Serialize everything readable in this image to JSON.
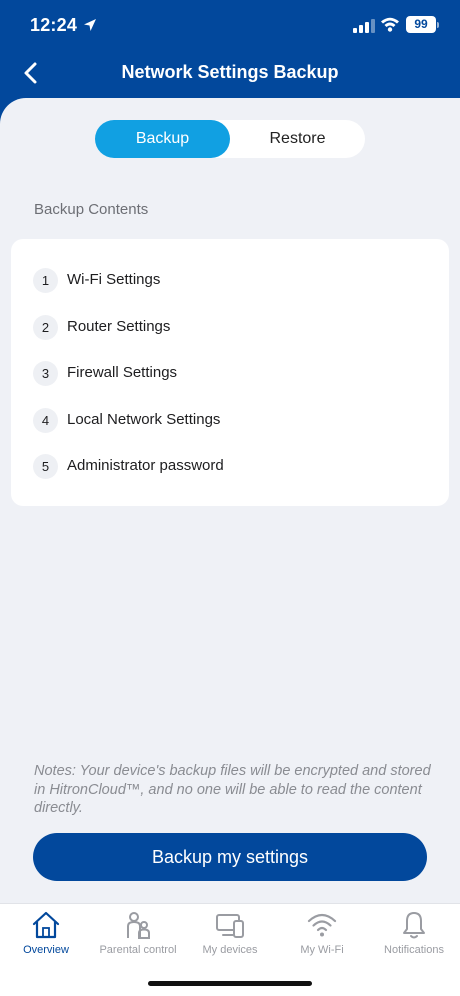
{
  "status_bar": {
    "time": "12:24",
    "battery": "99"
  },
  "header": {
    "title": "Network Settings Backup"
  },
  "segment": {
    "backup_label": "Backup",
    "restore_label": "Restore",
    "selected": "Backup"
  },
  "contents": {
    "label": "Backup Contents",
    "items": [
      {
        "num": "1",
        "label": "Wi-Fi Settings"
      },
      {
        "num": "2",
        "label": "Router Settings"
      },
      {
        "num": "3",
        "label": "Firewall Settings"
      },
      {
        "num": "4",
        "label": "Local Network Settings"
      },
      {
        "num": "5",
        "label": "Administrator password"
      }
    ]
  },
  "note": "Notes: Your device's backup files will be encrypted and stored in HitronCloud™, and no one will be able to read the content directly.",
  "cta_label": "Backup my settings",
  "tabbar": {
    "tabs": [
      {
        "label": "Overview",
        "icon": "home-icon",
        "active": true
      },
      {
        "label": "Parental control",
        "icon": "parental-icon",
        "active": false
      },
      {
        "label": "My devices",
        "icon": "devices-icon",
        "active": false
      },
      {
        "label": "My Wi-Fi",
        "icon": "wifi-icon",
        "active": false
      },
      {
        "label": "Notifications",
        "icon": "bell-icon",
        "active": false
      }
    ]
  },
  "colors": {
    "brand": "#02489c",
    "accent": "#11a0e2",
    "background": "#eff1f6"
  }
}
